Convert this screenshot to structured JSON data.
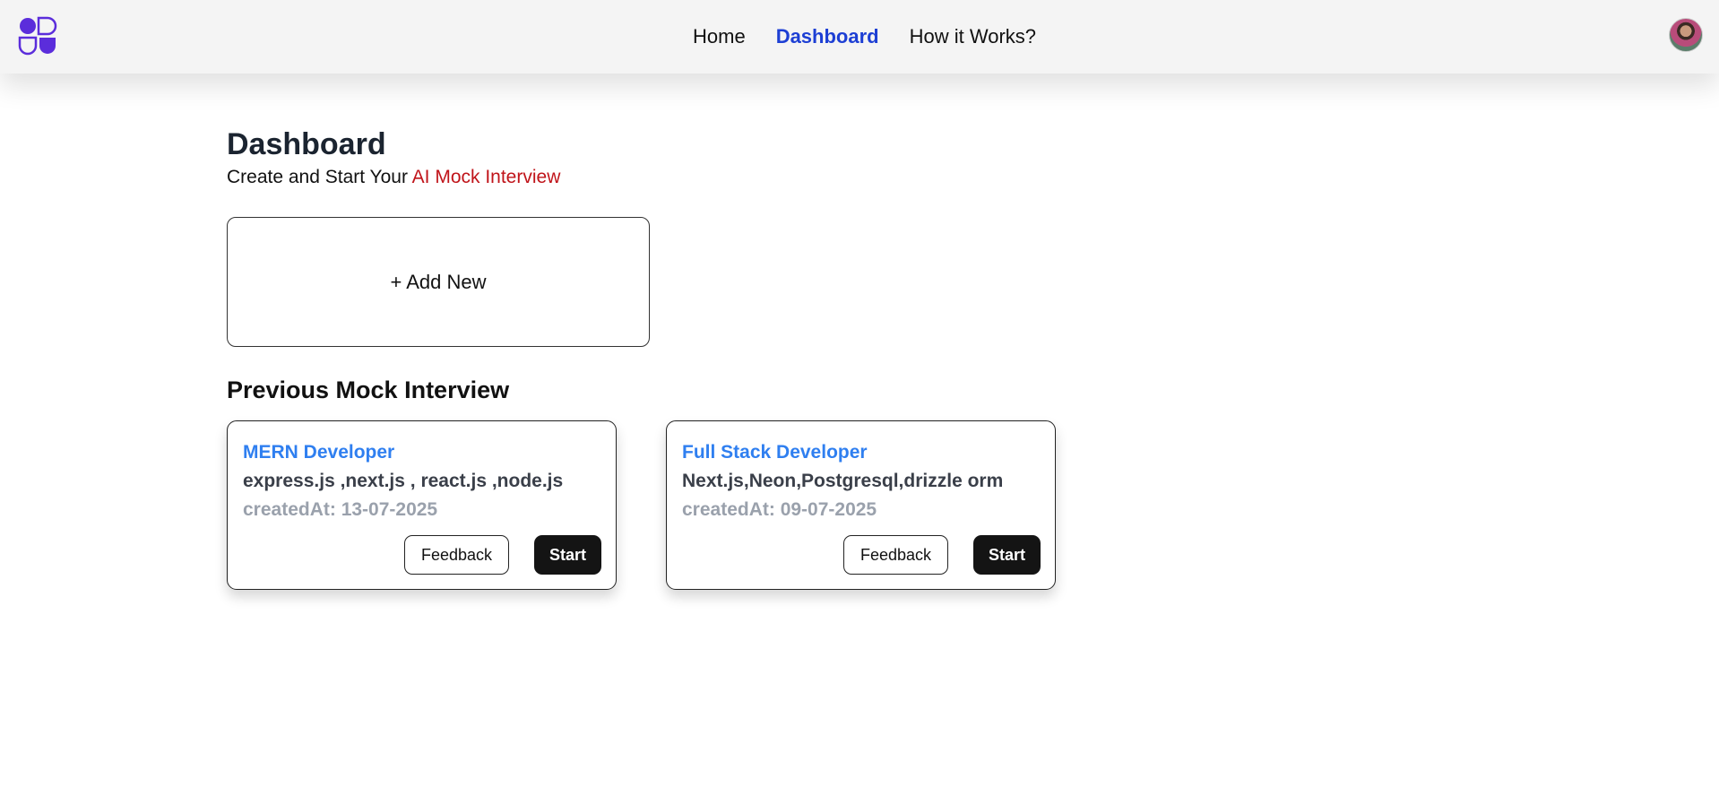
{
  "header": {
    "logo_icon": "quad-shapes-logo-icon",
    "brand_color": "#5b2ddb",
    "nav": [
      {
        "label": "Home",
        "active": false
      },
      {
        "label": "Dashboard",
        "active": true
      },
      {
        "label": "How it Works?",
        "active": false
      }
    ],
    "active_color": "#1d3fd4",
    "avatar_icon": "user-avatar"
  },
  "main": {
    "title": "Dashboard",
    "subtitle_prefix": "Create and Start Your ",
    "subtitle_accent": "AI Mock Interview",
    "accent_color": "#c0141a",
    "add_new_label": "+ Add New",
    "section_title": "Previous Mock Interview"
  },
  "interviews": [
    {
      "role": "MERN Developer",
      "tech": "express.js ,next.js , react.js ,node.js",
      "created": "createdAt: 13-07-2025",
      "feedback_label": "Feedback",
      "start_label": "Start"
    },
    {
      "role": "Full Stack Developer",
      "tech": "Next.js,Neon,Postgresql,drizzle orm",
      "created": "createdAt: 09-07-2025",
      "feedback_label": "Feedback",
      "start_label": "Start"
    }
  ]
}
